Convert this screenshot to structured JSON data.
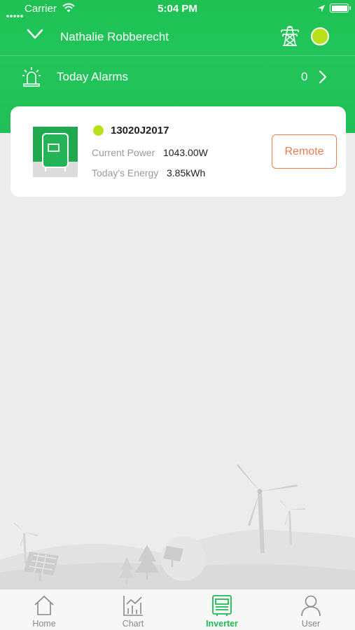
{
  "status_bar": {
    "carrier": "Carrier",
    "time": "5:04 PM"
  },
  "header": {
    "user_name": "Nathalie Robberecht",
    "station_status_color": "#b8e11a"
  },
  "alarms": {
    "label": "Today Alarms",
    "count": "0"
  },
  "inverter_card": {
    "serial": "13020J2017",
    "status_color": "#b8e11a",
    "current_power_label": "Current Power",
    "current_power_value": "1043.00W",
    "todays_energy_label": "Today's Energy",
    "todays_energy_value": "3.85kWh",
    "remote_label": "Remote"
  },
  "tabs": [
    {
      "label": "Home",
      "icon": "home-icon",
      "active": false
    },
    {
      "label": "Chart",
      "icon": "chart-icon",
      "active": false
    },
    {
      "label": "Inverter",
      "icon": "inverter-icon",
      "active": true
    },
    {
      "label": "User",
      "icon": "user-icon",
      "active": false
    }
  ],
  "colors": {
    "brand_green": "#21c055",
    "accent_orange": "#ee7b4c",
    "status_lime": "#b8e11a"
  }
}
